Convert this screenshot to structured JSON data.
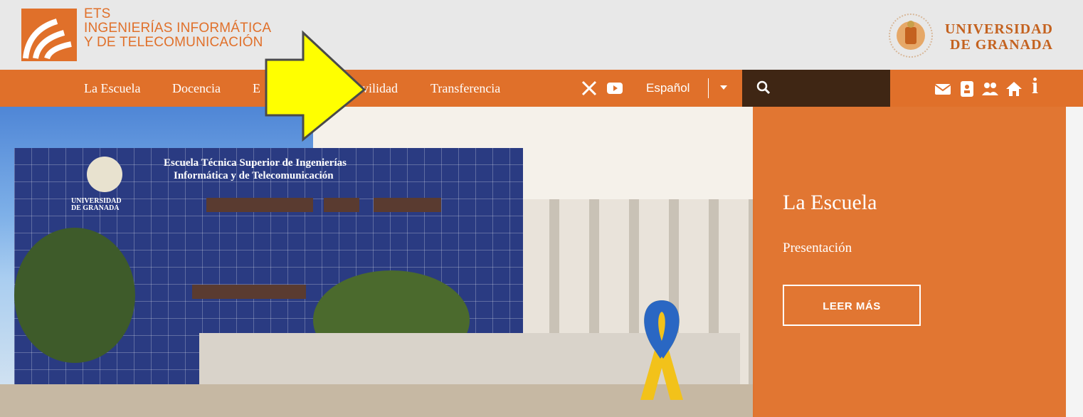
{
  "header": {
    "school_lines": [
      "ETS",
      "INGENIERÍAS INFORMÁTICA",
      "Y DE TELECOMUNICACIÓN"
    ],
    "university_lines": [
      "UNIVERSIDAD",
      "DE GRANADA"
    ],
    "brand_color": "#e0702a"
  },
  "nav": {
    "items": [
      "La Escuela",
      "Docencia",
      "E",
      "Movilidad",
      "Transferencia"
    ],
    "language": "Español",
    "social": [
      "x-icon",
      "youtube-icon"
    ],
    "tools": [
      "mail-icon",
      "contact-card-icon",
      "people-icon",
      "home-icon",
      "info-icon"
    ]
  },
  "hero": {
    "building_caption": [
      "Escuela Técnica Superior de Ingenierías",
      "Informática y de Telecomunicación"
    ],
    "building_ugr": [
      "UNIVERSIDAD",
      "DE GRANADA"
    ],
    "panel_title": "La Escuela",
    "panel_subtitle": "Presentación",
    "panel_button": "LEER MÁS"
  },
  "overlay": {
    "arrow_color": "#ffff00"
  }
}
